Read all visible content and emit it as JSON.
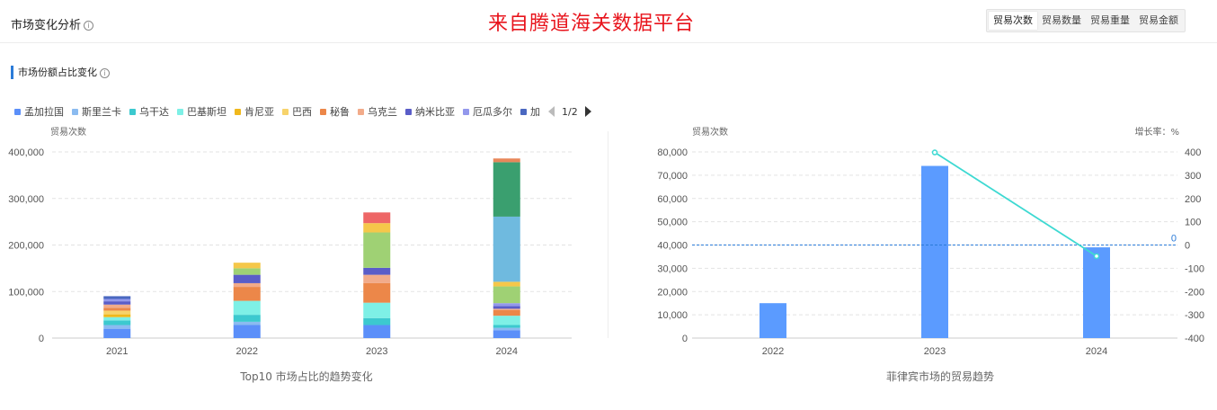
{
  "header": {
    "title": "市场变化分析",
    "info_glyph": "i",
    "watermark": "来自腾道海关数据平台",
    "tabs": [
      "贸易次数",
      "贸易数量",
      "贸易重量",
      "贸易金额"
    ],
    "active_tab": 0
  },
  "section": {
    "title": "市场份额占比变化",
    "info_glyph": "i"
  },
  "legend": {
    "items": [
      {
        "name": "孟加拉国",
        "color": "#5b8ff9"
      },
      {
        "name": "斯里兰卡",
        "color": "#8bbbf0"
      },
      {
        "name": "乌干达",
        "color": "#3cc9cf"
      },
      {
        "name": "巴基斯坦",
        "color": "#7ef0e6"
      },
      {
        "name": "肯尼亚",
        "color": "#f0b81c"
      },
      {
        "name": "巴西",
        "color": "#f7d36b"
      },
      {
        "name": "秘鲁",
        "color": "#ec8749"
      },
      {
        "name": "乌克兰",
        "color": "#f2ab8a"
      },
      {
        "name": "纳米比亚",
        "color": "#5a5dc8"
      },
      {
        "name": "厄瓜多尔",
        "color": "#9398ec"
      },
      {
        "name": "加",
        "color": "#4a68c0"
      }
    ],
    "page": "1/2"
  },
  "chart_data": [
    {
      "type": "bar",
      "stacked": true,
      "title": "Top10 市场占比的趋势变化",
      "ylabel": "贸易次数",
      "categories": [
        "2021",
        "2022",
        "2023",
        "2024"
      ],
      "ylim": [
        0,
        400000
      ],
      "yticks": [
        0,
        100000,
        200000,
        300000,
        400000
      ],
      "ytick_labels": [
        "0",
        "100,000",
        "200,000",
        "300,000",
        "400,000"
      ],
      "grid": true,
      "series": [
        {
          "color": "#5b8ff9",
          "values": [
            20000,
            28000,
            28000,
            17000
          ]
        },
        {
          "color": "#8bbbf0",
          "values": [
            8000,
            7000,
            0,
            5000
          ]
        },
        {
          "color": "#3cc9cf",
          "values": [
            10000,
            15000,
            15000,
            6000
          ]
        },
        {
          "color": "#7ef0e6",
          "values": [
            7000,
            30000,
            33000,
            20000
          ]
        },
        {
          "color": "#f0b81c",
          "values": [
            6000,
            0,
            0,
            0
          ]
        },
        {
          "color": "#f7d36b",
          "values": [
            8000,
            0,
            0,
            0
          ]
        },
        {
          "color": "#ec8749",
          "values": [
            6000,
            30000,
            42000,
            12000
          ]
        },
        {
          "color": "#f2ab8a",
          "values": [
            7000,
            8000,
            18000,
            3000
          ]
        },
        {
          "color": "#5a5dc8",
          "values": [
            7000,
            18000,
            15000,
            6000
          ]
        },
        {
          "color": "#9398ec",
          "values": [
            5000,
            0,
            0,
            6000
          ]
        },
        {
          "color": "#4a68c0",
          "values": [
            6000,
            0,
            0,
            0
          ]
        },
        {
          "color": "#9fd174",
          "values": [
            0,
            14000,
            76000,
            36000
          ]
        },
        {
          "color": "#f5c74a",
          "values": [
            0,
            12000,
            20000,
            10000
          ]
        },
        {
          "color": "#ee6666",
          "values": [
            0,
            0,
            23000,
            0
          ]
        },
        {
          "color": "#6fbadf",
          "values": [
            0,
            0,
            0,
            140000
          ]
        },
        {
          "color": "#3a9f6f",
          "values": [
            0,
            0,
            0,
            117000
          ]
        },
        {
          "color": "#e8875a",
          "values": [
            0,
            0,
            0,
            8000
          ]
        }
      ]
    },
    {
      "type": "bar",
      "title": "菲律宾市场的贸易趋势",
      "ylabel": "贸易次数",
      "y2label": "增长率：%",
      "categories": [
        "2022",
        "2023",
        "2024"
      ],
      "ylim": [
        0,
        80000
      ],
      "yticks": [
        0,
        10000,
        20000,
        30000,
        40000,
        50000,
        60000,
        70000,
        80000
      ],
      "ytick_labels": [
        "0",
        "10,000",
        "20,000",
        "30,000",
        "40,000",
        "50,000",
        "60,000",
        "70,000",
        "80,000"
      ],
      "y2lim": [
        -400,
        400
      ],
      "y2ticks": [
        -400,
        -300,
        -200,
        -100,
        0,
        100,
        200,
        300,
        400
      ],
      "y2tick_labels": [
        "-400",
        "-300",
        "-200",
        "-100",
        "0",
        "100",
        "200",
        "300",
        "400"
      ],
      "bar_color": "#5b9bff",
      "line_color": "#3dd9d2",
      "bar_values": [
        15000,
        74000,
        39000
      ],
      "growth_values": [
        null,
        398,
        -48
      ],
      "zero_line_label": "0",
      "zero_line_color": "#2b7bd8"
    }
  ]
}
